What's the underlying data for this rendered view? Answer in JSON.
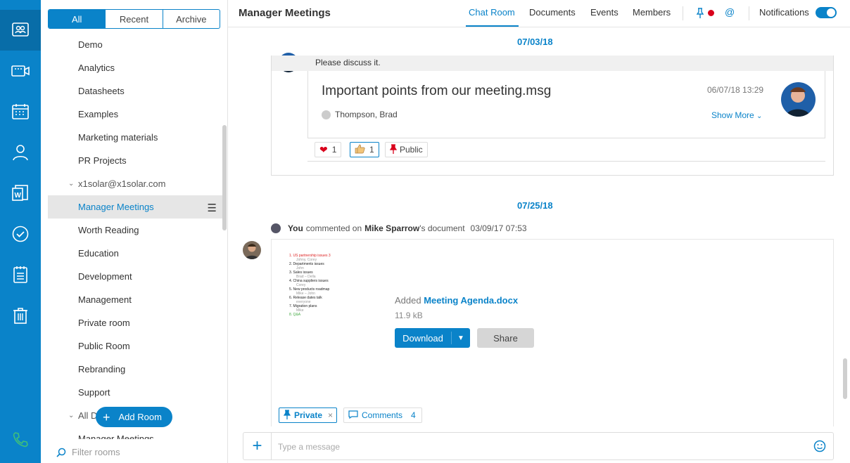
{
  "nav": {
    "items": [
      "rooms-icon",
      "video-icon",
      "calendar-icon",
      "contacts-icon",
      "word-icon",
      "tasks-icon",
      "notes-icon",
      "trash-icon",
      "phone-icon"
    ]
  },
  "rooms_panel": {
    "filters": [
      "All",
      "Recent",
      "Archive"
    ],
    "active_filter": "All",
    "rooms": [
      "Demo",
      "Analytics",
      "Datasheets",
      "Examples",
      "Marketing materials",
      "PR Projects"
    ],
    "group1": "x1solar@x1solar.com",
    "group1_rooms": [
      "Manager Meetings",
      "Worth Reading",
      "Education",
      "Development",
      "Management",
      "Private room",
      "Public Room",
      "Rebranding",
      "Support"
    ],
    "group2": "All Domains",
    "group2_rooms": [
      "Manager Meetings"
    ],
    "add_room": "Add Room",
    "filter_placeholder": "Filter rooms"
  },
  "header": {
    "title": "Manager Meetings",
    "tabs": [
      "Chat Room",
      "Documents",
      "Events",
      "Members"
    ],
    "active_tab": "Chat Room",
    "mention": "@",
    "notifications_label": "Notifications",
    "notifications_on": true
  },
  "chat": {
    "date1": "07/03/18",
    "msg1_text": "Please discuss it.",
    "file_title": "Important points from our meeting.msg",
    "file_date": "06/07/18 13:29",
    "file_author": "Thompson, Brad",
    "show_more": "Show More",
    "reactions": {
      "heart": "1",
      "thumbs": "1",
      "public": "Public"
    },
    "date2": "07/25/18",
    "activity": {
      "actor": "You",
      "verb": "commented on",
      "target": "Mike Sparrow",
      "suffix": "'s document",
      "time": "03/09/17 07:53"
    },
    "doc": {
      "added_label": "Added",
      "filename": "Meeting Agenda.docx",
      "size": "11.9 kB",
      "download": "Download",
      "share": "Share",
      "thumb_lines": [
        {
          "n": "1.",
          "t": "US partnership issues 3",
          "s": "Johny, Corey"
        },
        {
          "n": "2.",
          "t": "Departments issues",
          "s": "John"
        },
        {
          "n": "3.",
          "t": "Sales issues",
          "s": "Brad – Della"
        },
        {
          "n": "4.",
          "t": "China suppliers issues",
          "s": "Corey"
        },
        {
          "n": "5.",
          "t": "New products roadmap",
          "s": "Mike – John"
        },
        {
          "n": "6.",
          "t": "Release dates talk",
          "s": "everyone"
        },
        {
          "n": "7.",
          "t": "Migration plans",
          "s": "Mike"
        },
        {
          "n": "8.",
          "t": "Q&A",
          "s": ""
        }
      ]
    },
    "private_label": "Private",
    "comments_label": "Comments",
    "comments_count": "4",
    "composer_placeholder": "Type a message"
  }
}
